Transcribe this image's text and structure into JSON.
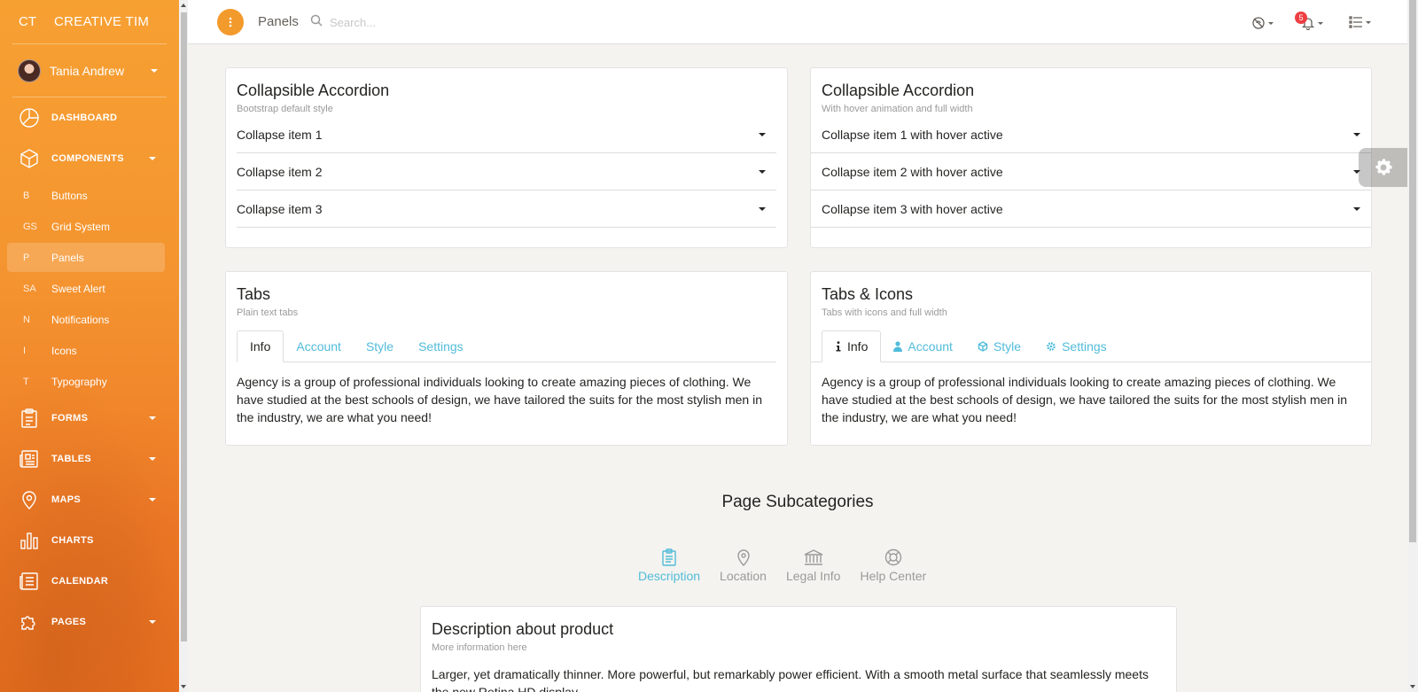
{
  "sidebar": {
    "logo_mini": "CT",
    "logo_full": "CREATIVE TIM",
    "user_name": "Tania Andrew",
    "nav": {
      "dashboard": "DASHBOARD",
      "components": "COMPONENTS",
      "forms": "FORMS",
      "tables": "TABLES",
      "maps": "MAPS",
      "charts": "CHARTS",
      "calendar": "CALENDAR",
      "pages": "PAGES"
    },
    "components_sub": [
      {
        "mini": "B",
        "label": "Buttons"
      },
      {
        "mini": "GS",
        "label": "Grid System"
      },
      {
        "mini": "P",
        "label": "Panels"
      },
      {
        "mini": "SA",
        "label": "Sweet Alert"
      },
      {
        "mini": "N",
        "label": "Notifications"
      },
      {
        "mini": "I",
        "label": "Icons"
      },
      {
        "mini": "T",
        "label": "Typography"
      }
    ],
    "active_sub": "Panels"
  },
  "topbar": {
    "brand": "Panels",
    "search_placeholder": "Search...",
    "notification_count": "5"
  },
  "accordion_default": {
    "title": "Collapsible Accordion",
    "subtitle": "Bootstrap default style",
    "items": [
      "Collapse item 1",
      "Collapse item 2",
      "Collapse item 3"
    ]
  },
  "accordion_hover": {
    "title": "Collapsible Accordion",
    "subtitle": "With hover animation and full width",
    "items": [
      "Collapse item 1 with hover active",
      "Collapse item 2 with hover active",
      "Collapse item 3 with hover active"
    ]
  },
  "tabs_plain": {
    "title": "Tabs",
    "subtitle": "Plain text tabs",
    "tabs": [
      "Info",
      "Account",
      "Style",
      "Settings"
    ],
    "active_tab": "Info",
    "content": "Agency is a group of professional individuals looking to create amazing pieces of clothing. We have studied at the best schools of design, we have tailored the suits for the most stylish men in the industry, we are what you need!"
  },
  "tabs_icons": {
    "title": "Tabs & Icons",
    "subtitle": "Tabs with icons and full width",
    "tabs": [
      {
        "label": "Info",
        "icon": "info-icon"
      },
      {
        "label": "Account",
        "icon": "user-icon"
      },
      {
        "label": "Style",
        "icon": "cube-icon"
      },
      {
        "label": "Settings",
        "icon": "gear-icon"
      }
    ],
    "active_tab": "Info",
    "content": "Agency is a group of professional individuals looking to create amazing pieces of clothing. We have studied at the best schools of design, we have tailored the suits for the most stylish men in the industry, we are what you need!"
  },
  "subcategories": {
    "title": "Page Subcategories",
    "items": [
      {
        "label": "Description",
        "icon": "clipboard-icon"
      },
      {
        "label": "Location",
        "icon": "location-pin-icon"
      },
      {
        "label": "Legal Info",
        "icon": "bank-icon"
      },
      {
        "label": "Help Center",
        "icon": "lifebuoy-icon"
      }
    ],
    "active": "Description"
  },
  "description_card": {
    "title": "Description about product",
    "subtitle": "More information here",
    "text": "Larger, yet dramatically thinner. More powerful, but remarkably power efficient. With a smooth metal surface that seamlessly meets the new Retina HD display."
  },
  "colors": {
    "sidebar_orange": "#f39a2c",
    "accent_cyan": "#51bcda",
    "badge_red": "#ef3e42",
    "background": "#f4f3ef"
  }
}
